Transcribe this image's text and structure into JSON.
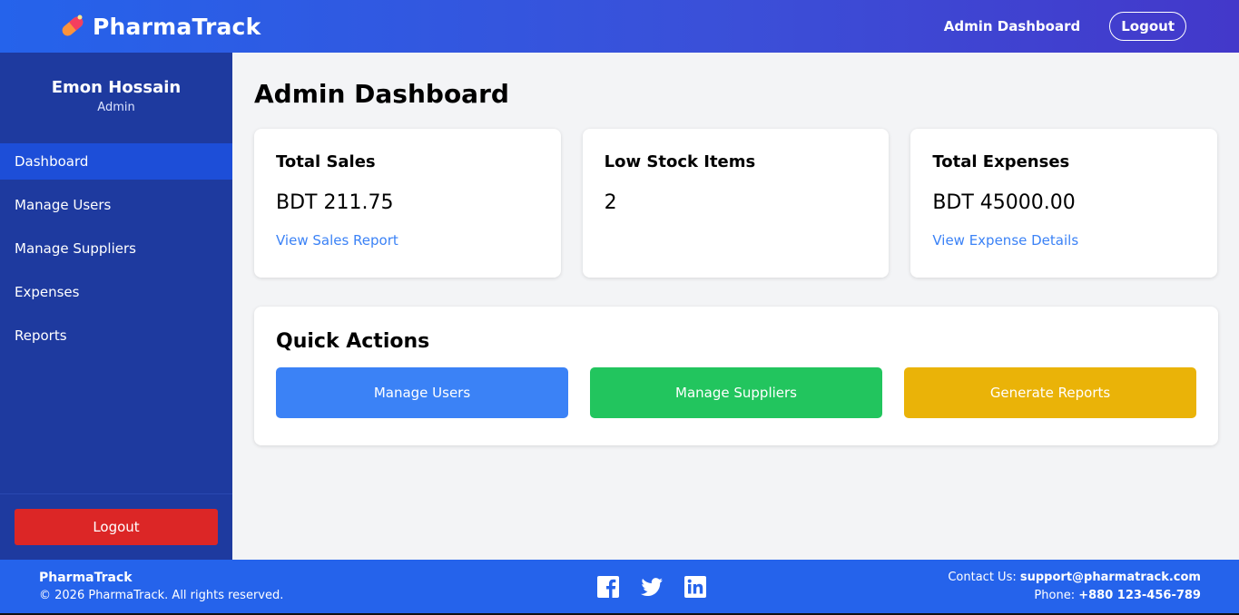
{
  "header": {
    "brand": "PharmaTrack",
    "nav_link": "Admin Dashboard",
    "logout_label": "Logout"
  },
  "sidebar": {
    "user_name": "Emon Hossain",
    "user_role": "Admin",
    "items": [
      {
        "label": "Dashboard",
        "active": true
      },
      {
        "label": "Manage Users",
        "active": false
      },
      {
        "label": "Manage Suppliers",
        "active": false
      },
      {
        "label": "Expenses",
        "active": false
      },
      {
        "label": "Reports",
        "active": false
      }
    ],
    "logout_label": "Logout"
  },
  "main": {
    "title": "Admin Dashboard",
    "cards": [
      {
        "title": "Total Sales",
        "value": "BDT 211.75",
        "link": "View Sales Report"
      },
      {
        "title": "Low Stock Items",
        "value": "2",
        "link": ""
      },
      {
        "title": "Total Expenses",
        "value": "BDT 45000.00",
        "link": "View Expense Details"
      }
    ],
    "quick_actions": {
      "title": "Quick Actions",
      "buttons": [
        {
          "label": "Manage Users",
          "color": "#3b82f6"
        },
        {
          "label": "Manage Suppliers",
          "color": "#22c55e"
        },
        {
          "label": "Generate Reports",
          "color": "#eab308"
        }
      ]
    }
  },
  "footer": {
    "brand": "PharmaTrack",
    "copyright": "© 2026 PharmaTrack. All rights reserved.",
    "contact_label": "Contact Us:",
    "contact_email": "support@pharmatrack.com",
    "phone_label": "Phone:",
    "phone_number": "+880 123-456-789",
    "social": [
      "facebook-icon",
      "twitter-icon",
      "linkedin-icon"
    ]
  },
  "colors": {
    "header_gradient_start": "#2563eb",
    "header_gradient_end": "#4338ca",
    "sidebar_bg": "#1e3a9f",
    "sidebar_active": "#1d4ed8",
    "logout_red": "#dc2626",
    "link_blue": "#3b82f6",
    "footer_bg": "#2563eb"
  }
}
